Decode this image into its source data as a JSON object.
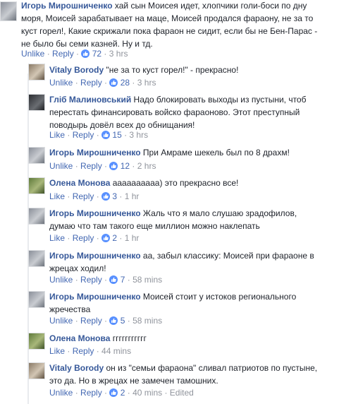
{
  "main_comment": {
    "author": "Игорь Мирошниченко",
    "text_line1": " хай сын Моисея идет, хлопчики голи-боси по дну",
    "text_line2": "моря, Моисей зарабатывает на маце, Моисей продался фараону, не за то",
    "text_line3": "куст горел!, Какие скрижали пока фараон не сидит, если бы не Бен-Парас -",
    "text_line4": "не было бы семи казней. Ну и тд.",
    "unlike": "Unlike",
    "reply": "Reply",
    "likes": "72",
    "time": "3 hrs"
  },
  "replies": [
    {
      "author": "Vitaly Borody",
      "line1": " \"не за то куст горел!\" - прекрасно!",
      "line2": "",
      "action": "Unlike",
      "reply": "Reply",
      "likes": "28",
      "time": "3 hrs"
    },
    {
      "author": "Гліб Малиновський",
      "line1": " Надо блокировать выходы из пустыни, чтоб",
      "line2": "перестать финансировать войско фараоново. Этот преступный",
      "line3": "поводырь довёл всех до обнищания!",
      "action": "Like",
      "reply": "Reply",
      "likes": "15",
      "time": "3 hrs"
    },
    {
      "author": "Игорь Мирошниченко",
      "line1": " При Амраме шекель был по 8 драхм!",
      "action": "Unlike",
      "reply": "Reply",
      "likes": "12",
      "time": "2 hrs"
    },
    {
      "author": "Олена Монова",
      "line1": " аааааааааа) это прекрасно все!",
      "action": "Like",
      "reply": "Reply",
      "likes": "3",
      "time": "1 hr"
    },
    {
      "author": "Игорь Мирошниченко",
      "line1": " Жаль что я мало слушаю зрадофилов,",
      "line2": "думаю что там такого еще миллион можно наклепать",
      "action": "Like",
      "reply": "Reply",
      "likes": "2",
      "time": "1 hr"
    },
    {
      "author": "Игорь Мирошниченко",
      "line1": " аа, забыл классику: Моисей при фараоне в",
      "line2": "жрецах ходил!",
      "action": "Unlike",
      "reply": "Reply",
      "likes": "7",
      "time": "58 mins"
    },
    {
      "author": "Игорь Мирошниченко",
      "line1": " Моисей стоит у истоков регионального",
      "line2": "жречества",
      "action": "Unlike",
      "reply": "Reply",
      "likes": "5",
      "time": "58 mins"
    },
    {
      "author": "Олена Монова",
      "line1": " ггггггггггг",
      "action": "Like",
      "reply": "Reply",
      "time": "44 mins"
    },
    {
      "author": "Vitaly Borody",
      "line1": " он из \"семьи фараона\" сливал патриотов по пустыне,",
      "line2": "это да. Но в жрецах не замечен тамошних.",
      "action": "Unlike",
      "reply": "Reply",
      "likes": "2",
      "time": "40 mins",
      "edited": "Edited"
    }
  ]
}
